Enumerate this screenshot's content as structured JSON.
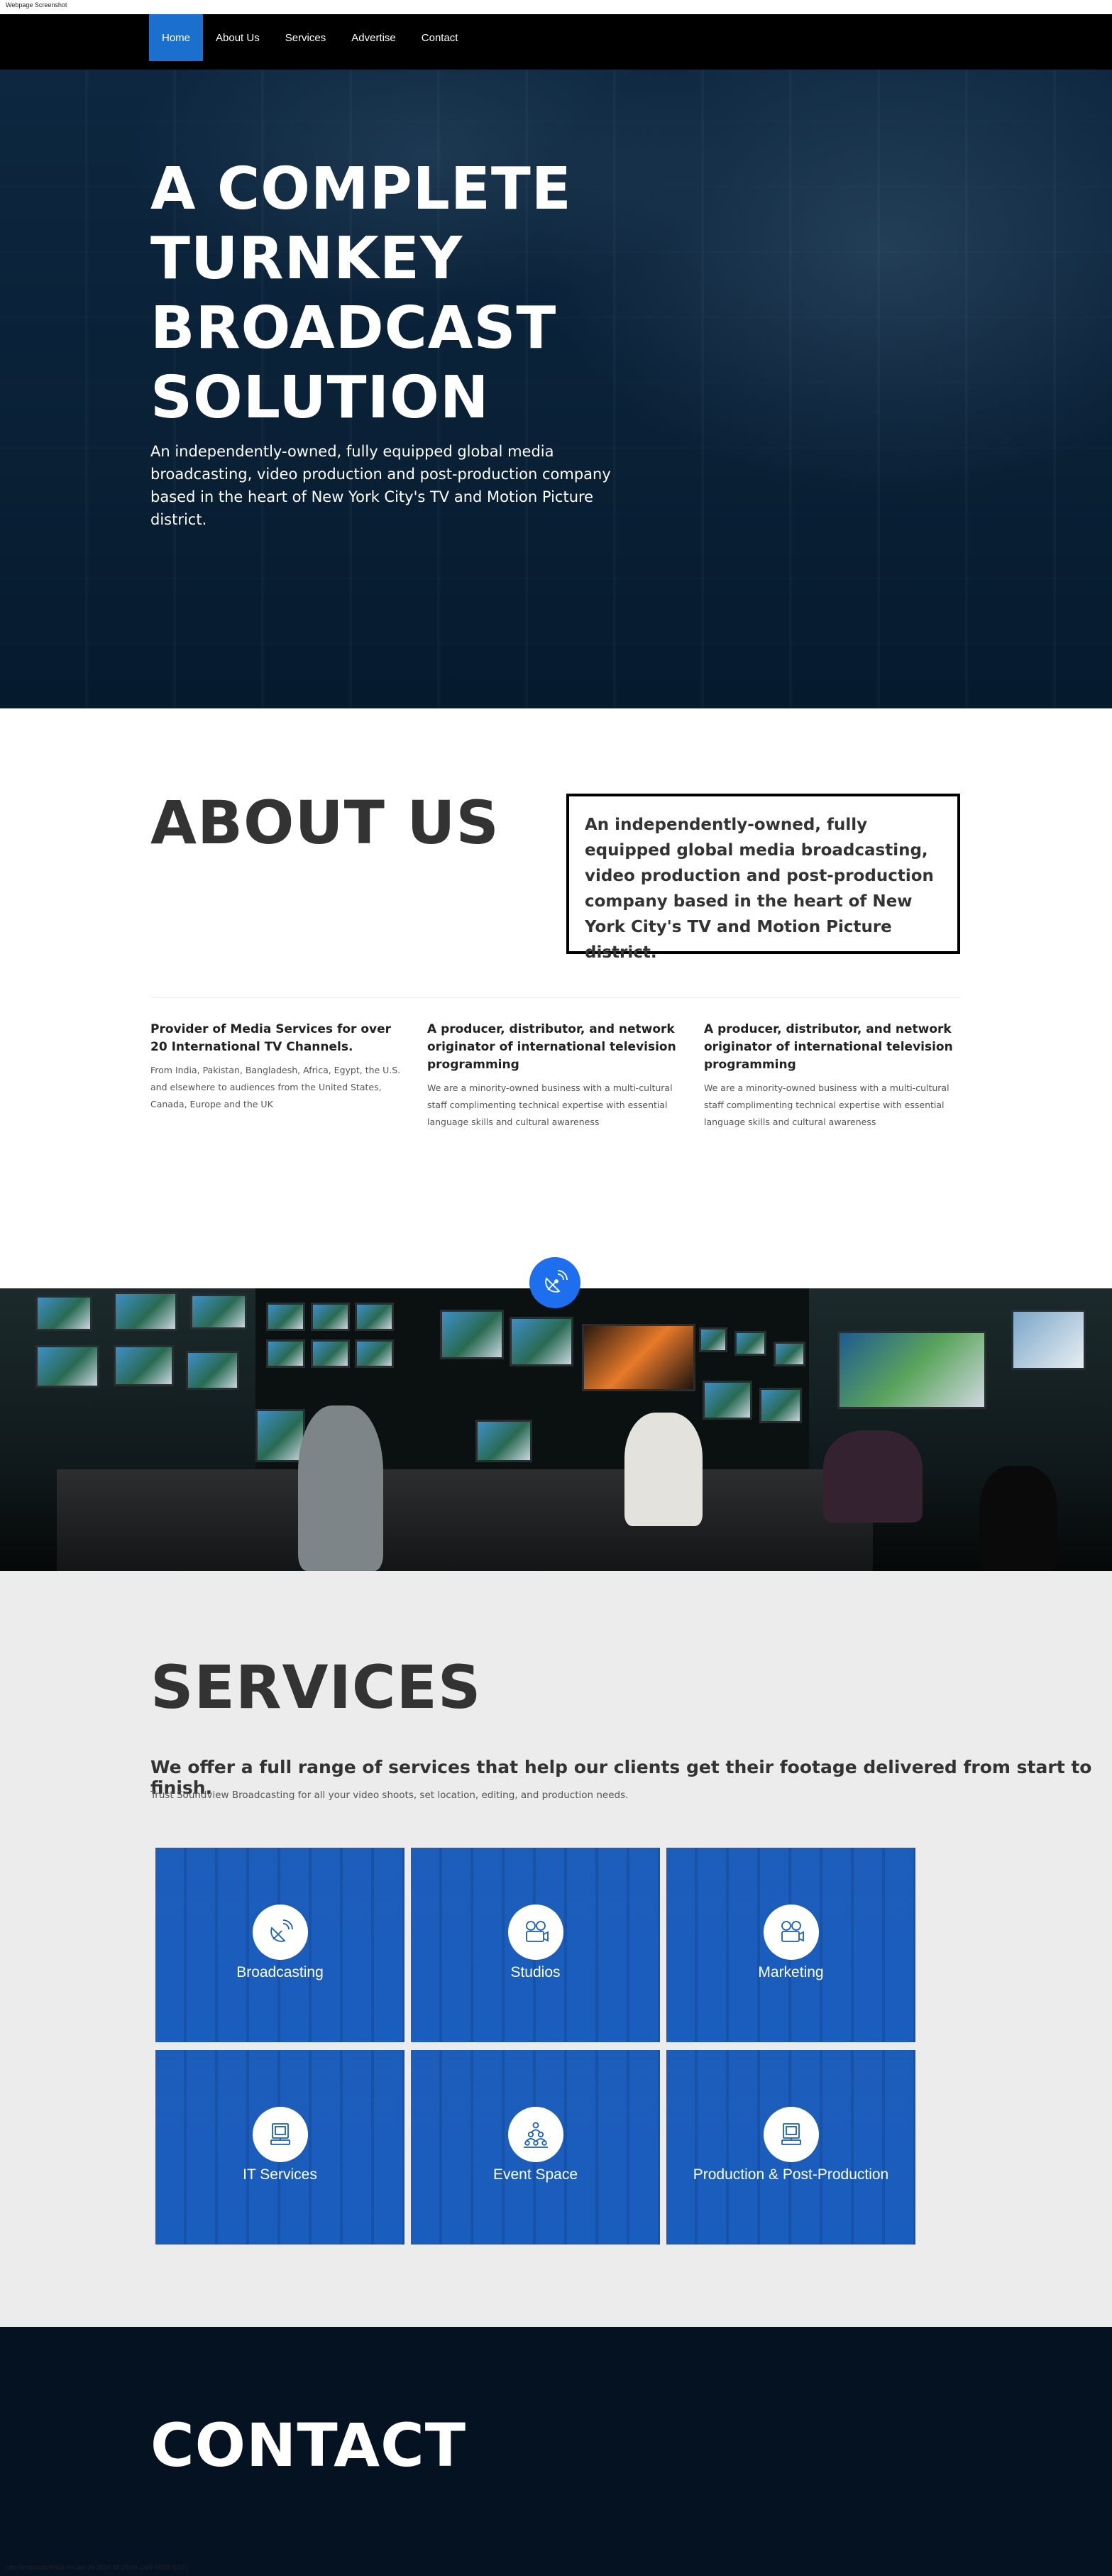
{
  "meta": {
    "top_caption": "Webpage Screenshot",
    "bottom_caption": "http://localhost:9002/ Fri Jan 29 2016 18:29:09 GMT-0500 (EST)"
  },
  "nav": {
    "items": [
      {
        "label": "Home",
        "active": true
      },
      {
        "label": "About Us"
      },
      {
        "label": "Services"
      },
      {
        "label": "Advertise"
      },
      {
        "label": "Contact"
      }
    ]
  },
  "hero": {
    "title_lines": [
      "A COMPLETE",
      "TURNKEY",
      "BROADCAST",
      "SOLUTION"
    ],
    "subtitle_lines": [
      "An independently-owned, fully equipped global media",
      "broadcasting, video production and post-production company",
      "based in the heart of New York City's TV and Motion Picture district."
    ]
  },
  "about": {
    "title": "ABOUT US",
    "box_text": "An independently-owned, fully equipped global media broadcasting, video production and post-production company based in the heart of New York City's TV and Motion Picture district.",
    "columns": [
      {
        "heading": "Provider of Media Services for over 20 International TV Channels.",
        "body": "From India, Pakistan, Bangladesh, Africa, Egypt, the U.S. and elsewhere to audiences from the United States, Canada, Europe and the UK"
      },
      {
        "heading": "A producer, distributor, and network originator of international television programming",
        "body": "We are a minority-owned business with a multi-cultural staff complimenting technical expertise with essential language skills and cultural awareness"
      },
      {
        "heading": "A producer, distributor, and network originator of international television programming",
        "body": "We are a minority-owned business with a multi-cultural staff complimenting technical expertise with essential language skills and cultural awareness"
      }
    ]
  },
  "services": {
    "title": "SERVICES",
    "lead": "We offer a full range of services that help our clients get their footage delivered from start to finish.",
    "sub": "Trust Soundview Broadcasting for all your video shoots, set location, editing, and production needs.",
    "tiles": [
      {
        "label": "Broadcasting",
        "icon": "satellite-dish-icon"
      },
      {
        "label": "Studios",
        "icon": "film-camera-icon"
      },
      {
        "label": "Marketing",
        "icon": "film-camera-icon"
      },
      {
        "label": "IT Services",
        "icon": "computer-icon"
      },
      {
        "label": "Event Space",
        "icon": "audience-icon"
      },
      {
        "label": "Production & Post-Production",
        "icon": "computer-icon"
      }
    ],
    "tile_color": "#1a5fc0"
  },
  "contact": {
    "title": "CONTACT"
  },
  "colors": {
    "accent": "#1a6fcf",
    "float_icon": "#1e6ff0",
    "contact_bg": "#041222"
  }
}
